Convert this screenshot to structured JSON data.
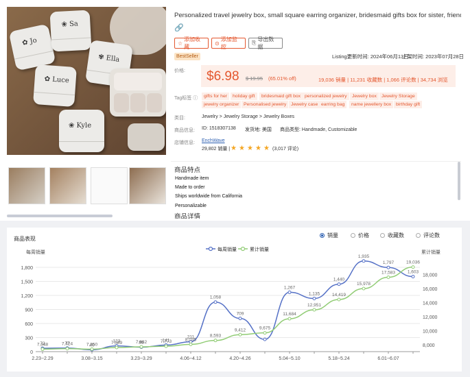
{
  "product": {
    "title": "Personalized travel jewelry box, small square earring organizer, bridesmaid gifts box for sister, friend",
    "actions": {
      "favorite": "添加收藏",
      "monitor": "添加监控",
      "export": "导出数据"
    },
    "badge": "BestSeller",
    "listing_updated": "Listing更新时间: 2024年06月13日",
    "listed_date": "上架时间: 2023年07月28日",
    "price_label": "价格:",
    "price": "$6.98",
    "original_price": "$ 19.95",
    "discount": "(65.01% off)",
    "stats": "19,036 销量 | 11,231 收藏数 | 1,066 评论数 | 34,734 浏览",
    "tags_label": "Tag标签",
    "tags": [
      "gifts for her",
      "holiday gift",
      "bridesmaid gift box",
      "personalized jewelry",
      "Jewelry box",
      "Jewelry Storage",
      "jewelry organizer",
      "Personalised jewelry",
      "Jewelry case",
      "earring bag",
      "name jewellery box",
      "birthday gift"
    ],
    "category_label": "类目:",
    "category": "Jewelry > Jewelry Storage > Jewelry Boxes",
    "info_label": "商品信息:",
    "id_text": "ID: 1518307138",
    "ship_from": "发货地: 美国",
    "product_type": "商品类型: Handmade, Customizable",
    "shop_label": "店铺信息:",
    "shop_name": "EnchWave",
    "shop_sales": "29,802 销量 |",
    "rating_count": "(3,017 评论)",
    "rating": 5
  },
  "features": {
    "heading": "商品特点",
    "items": [
      "Handmade item",
      "Made to order",
      "Ships worldwide from California",
      "Personalizable"
    ],
    "details_heading": "商品详情"
  },
  "chart_panel": {
    "title": "商品表现",
    "options": [
      {
        "label": "销量",
        "selected": true
      },
      {
        "label": "价格",
        "selected": false
      },
      {
        "label": "收藏数",
        "selected": false
      },
      {
        "label": "评论数",
        "selected": false
      }
    ]
  },
  "chart_data": {
    "type": "line",
    "ylabel_left": "每周销量",
    "ylabel_right": "累计销量",
    "x": [
      "2.23~2.29",
      "",
      "3.08~3.15",
      "",
      "3.23~3.29",
      "",
      "4.06~4.12",
      "",
      "4.20~4.26",
      "",
      "5.04~5.10",
      "",
      "5.18~5.24",
      "",
      "6.01~6.07",
      ""
    ],
    "x_ticks_shown": [
      "2.23~2.29",
      "3.08~3.15",
      "3.23~3.29",
      "4.06~4.12",
      "4.20~4.26",
      "5.04~5.10",
      "5.18~5.24",
      "6.01~6.07"
    ],
    "ylim_left": [
      0,
      1800
    ],
    "yticks_left": [
      0,
      300,
      600,
      900,
      1200,
      1500,
      1800
    ],
    "ylim_right": [
      7000,
      19000
    ],
    "yticks_right": [
      8000,
      10000,
      12000,
      14000,
      16000,
      18000
    ],
    "series": [
      {
        "name": "每周销量",
        "axis": "left",
        "color": "#5470c6",
        "values": [
          72,
          77,
          40,
          123,
          95,
          141,
          211,
          1058,
          709,
          261,
          1267,
          1135,
          1440,
          1935,
          1797,
          1603
        ],
        "labels": [
          "72",
          "77",
          "40",
          "123",
          "95",
          "141",
          "211",
          "1,058",
          "709",
          "",
          "1,267",
          "1,135",
          "1,440",
          "1,935",
          "1,797",
          "1,603"
        ]
      },
      {
        "name": "累计销量",
        "axis": "right",
        "color": "#91cc75",
        "values": [
          7348,
          7424,
          7350,
          7589,
          7682,
          7773,
          8035,
          8593,
          9412,
          9675,
          11684,
          12951,
          14419,
          15978,
          17583,
          19036
        ],
        "labels": [
          "7,348",
          "7,424",
          "7,350",
          "7,589",
          "7,682",
          "7,773",
          "8,035",
          "8,593",
          "9,412",
          "9,675",
          "11,684",
          "12,951",
          "14,419",
          "15,978",
          "17,583",
          "19,036"
        ]
      }
    ],
    "grid": true,
    "legend": "top-center"
  },
  "colors": {
    "accent": "#e4572e",
    "link": "#2a5db0",
    "star": "#f4a623"
  }
}
